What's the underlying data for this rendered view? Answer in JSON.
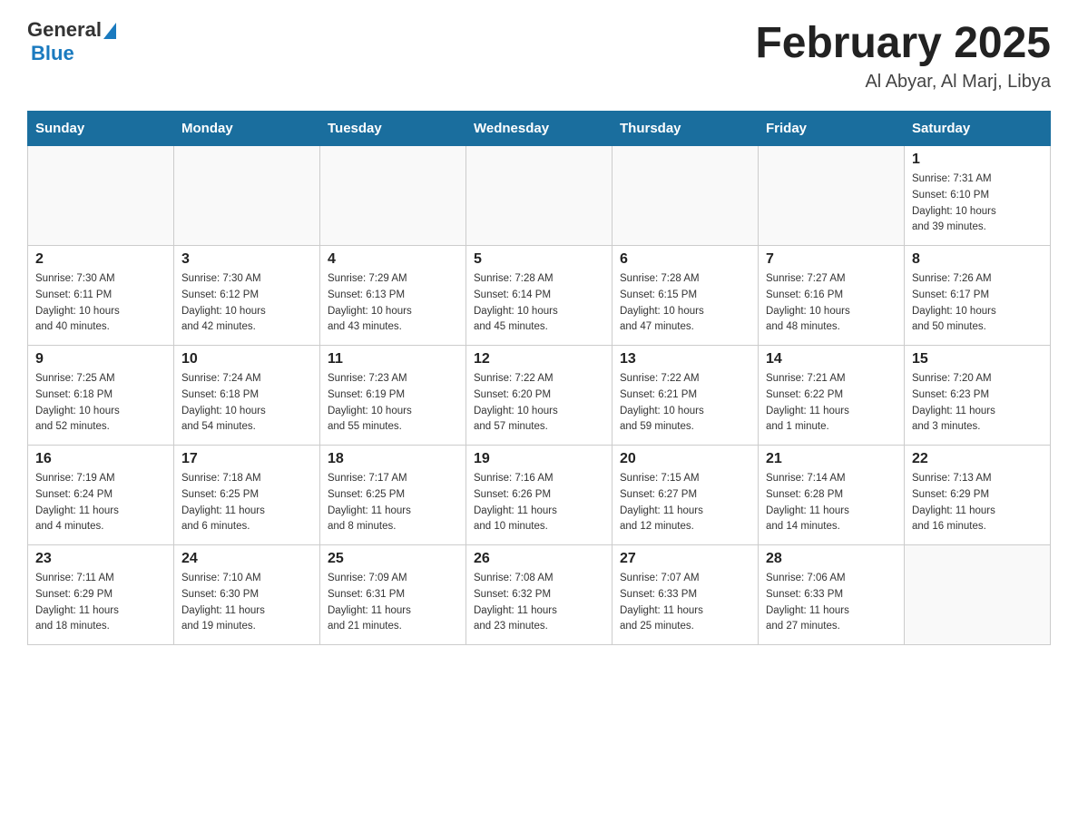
{
  "header": {
    "logo_general": "General",
    "logo_blue": "Blue",
    "month_title": "February 2025",
    "location": "Al Abyar, Al Marj, Libya"
  },
  "weekdays": [
    "Sunday",
    "Monday",
    "Tuesday",
    "Wednesday",
    "Thursday",
    "Friday",
    "Saturday"
  ],
  "weeks": [
    [
      {
        "day": "",
        "info": ""
      },
      {
        "day": "",
        "info": ""
      },
      {
        "day": "",
        "info": ""
      },
      {
        "day": "",
        "info": ""
      },
      {
        "day": "",
        "info": ""
      },
      {
        "day": "",
        "info": ""
      },
      {
        "day": "1",
        "info": "Sunrise: 7:31 AM\nSunset: 6:10 PM\nDaylight: 10 hours\nand 39 minutes."
      }
    ],
    [
      {
        "day": "2",
        "info": "Sunrise: 7:30 AM\nSunset: 6:11 PM\nDaylight: 10 hours\nand 40 minutes."
      },
      {
        "day": "3",
        "info": "Sunrise: 7:30 AM\nSunset: 6:12 PM\nDaylight: 10 hours\nand 42 minutes."
      },
      {
        "day": "4",
        "info": "Sunrise: 7:29 AM\nSunset: 6:13 PM\nDaylight: 10 hours\nand 43 minutes."
      },
      {
        "day": "5",
        "info": "Sunrise: 7:28 AM\nSunset: 6:14 PM\nDaylight: 10 hours\nand 45 minutes."
      },
      {
        "day": "6",
        "info": "Sunrise: 7:28 AM\nSunset: 6:15 PM\nDaylight: 10 hours\nand 47 minutes."
      },
      {
        "day": "7",
        "info": "Sunrise: 7:27 AM\nSunset: 6:16 PM\nDaylight: 10 hours\nand 48 minutes."
      },
      {
        "day": "8",
        "info": "Sunrise: 7:26 AM\nSunset: 6:17 PM\nDaylight: 10 hours\nand 50 minutes."
      }
    ],
    [
      {
        "day": "9",
        "info": "Sunrise: 7:25 AM\nSunset: 6:18 PM\nDaylight: 10 hours\nand 52 minutes."
      },
      {
        "day": "10",
        "info": "Sunrise: 7:24 AM\nSunset: 6:18 PM\nDaylight: 10 hours\nand 54 minutes."
      },
      {
        "day": "11",
        "info": "Sunrise: 7:23 AM\nSunset: 6:19 PM\nDaylight: 10 hours\nand 55 minutes."
      },
      {
        "day": "12",
        "info": "Sunrise: 7:22 AM\nSunset: 6:20 PM\nDaylight: 10 hours\nand 57 minutes."
      },
      {
        "day": "13",
        "info": "Sunrise: 7:22 AM\nSunset: 6:21 PM\nDaylight: 10 hours\nand 59 minutes."
      },
      {
        "day": "14",
        "info": "Sunrise: 7:21 AM\nSunset: 6:22 PM\nDaylight: 11 hours\nand 1 minute."
      },
      {
        "day": "15",
        "info": "Sunrise: 7:20 AM\nSunset: 6:23 PM\nDaylight: 11 hours\nand 3 minutes."
      }
    ],
    [
      {
        "day": "16",
        "info": "Sunrise: 7:19 AM\nSunset: 6:24 PM\nDaylight: 11 hours\nand 4 minutes."
      },
      {
        "day": "17",
        "info": "Sunrise: 7:18 AM\nSunset: 6:25 PM\nDaylight: 11 hours\nand 6 minutes."
      },
      {
        "day": "18",
        "info": "Sunrise: 7:17 AM\nSunset: 6:25 PM\nDaylight: 11 hours\nand 8 minutes."
      },
      {
        "day": "19",
        "info": "Sunrise: 7:16 AM\nSunset: 6:26 PM\nDaylight: 11 hours\nand 10 minutes."
      },
      {
        "day": "20",
        "info": "Sunrise: 7:15 AM\nSunset: 6:27 PM\nDaylight: 11 hours\nand 12 minutes."
      },
      {
        "day": "21",
        "info": "Sunrise: 7:14 AM\nSunset: 6:28 PM\nDaylight: 11 hours\nand 14 minutes."
      },
      {
        "day": "22",
        "info": "Sunrise: 7:13 AM\nSunset: 6:29 PM\nDaylight: 11 hours\nand 16 minutes."
      }
    ],
    [
      {
        "day": "23",
        "info": "Sunrise: 7:11 AM\nSunset: 6:29 PM\nDaylight: 11 hours\nand 18 minutes."
      },
      {
        "day": "24",
        "info": "Sunrise: 7:10 AM\nSunset: 6:30 PM\nDaylight: 11 hours\nand 19 minutes."
      },
      {
        "day": "25",
        "info": "Sunrise: 7:09 AM\nSunset: 6:31 PM\nDaylight: 11 hours\nand 21 minutes."
      },
      {
        "day": "26",
        "info": "Sunrise: 7:08 AM\nSunset: 6:32 PM\nDaylight: 11 hours\nand 23 minutes."
      },
      {
        "day": "27",
        "info": "Sunrise: 7:07 AM\nSunset: 6:33 PM\nDaylight: 11 hours\nand 25 minutes."
      },
      {
        "day": "28",
        "info": "Sunrise: 7:06 AM\nSunset: 6:33 PM\nDaylight: 11 hours\nand 27 minutes."
      },
      {
        "day": "",
        "info": ""
      }
    ]
  ]
}
